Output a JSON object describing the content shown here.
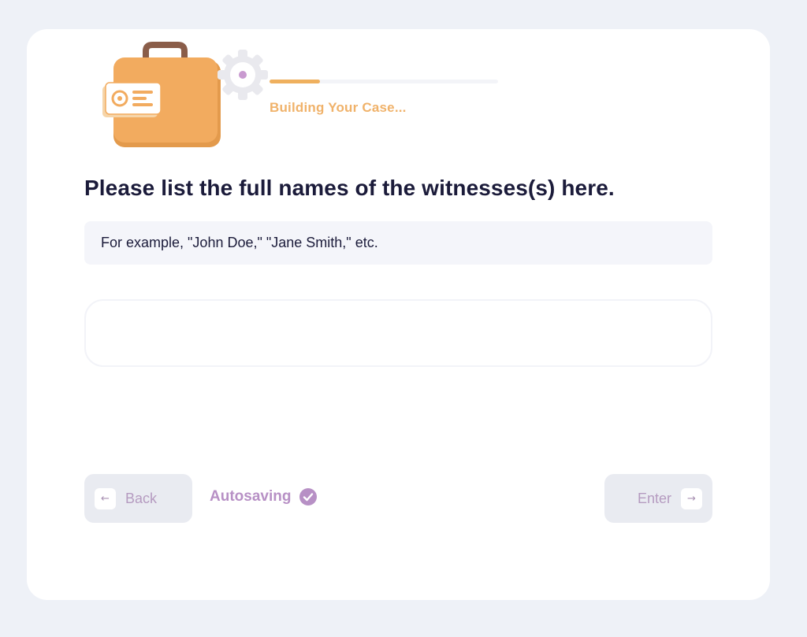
{
  "progress": {
    "fraction": 0.22,
    "status_text": "Building Your Case..."
  },
  "question": {
    "title": "Please list the full names of the witnesses(s) here.",
    "hint": "For example, \"John Doe,\" \"Jane Smith,\" etc."
  },
  "answer": {
    "value": "",
    "placeholder": ""
  },
  "footer": {
    "back_label": "Back",
    "back_icon": "arrow-left-icon",
    "autosave_label": "Autosaving",
    "autosave_icon": "check-circle-icon",
    "enter_label": "Enter",
    "enter_icon": "arrow-right-icon"
  },
  "colors": {
    "accent_orange": "#efb05e",
    "accent_purple": "#b790c5",
    "text_dark": "#1b1b3a",
    "background": "#eef1f7"
  }
}
